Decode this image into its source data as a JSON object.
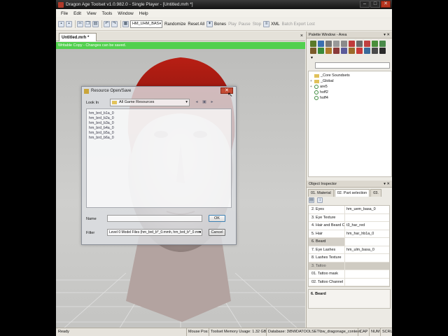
{
  "window": {
    "title": "Dragon Age Toolset v1.0.982.0 - Single Player - [Untitled.mrh *]",
    "minimize": "–",
    "maximize": "□",
    "close": "✕"
  },
  "menu": [
    "File",
    "Edit",
    "View",
    "Tools",
    "Window",
    "Help"
  ],
  "toolbar": {
    "model_combo": "HM_UHM_BAS",
    "buttons": [
      "Randomize",
      "Reset All",
      "Bones"
    ],
    "disabled_buttons": [
      "Play",
      "Pause",
      "Stop"
    ],
    "xml": "XML",
    "batch_export": "Batch Export Lost"
  },
  "document": {
    "tab_label": "Untitled.mrh *",
    "notice": "Writable Copy - Changes can be saved."
  },
  "dialog": {
    "title": "Resource Open/Save",
    "close": "✕",
    "look_in_label": "Look In",
    "look_in_value": "All Game Resources",
    "files": [
      "hm_brd_b1a_0",
      "hm_brd_b2a_0",
      "hm_brd_b3a_0",
      "hm_brd_b4a_0",
      "hm_brd_b5a_0",
      "hm_brd_b6a_0"
    ],
    "name_label": "Name",
    "name_value": "",
    "filter_label": "Filter",
    "filter_value": "Level 0 Model Files (hm_brd_b*_0.mmh, hm_brd_b*_0.mm",
    "ok": "OK",
    "cancel": "Cancel"
  },
  "palette": {
    "title": "Palette Window - Area",
    "pin": "▾ ✕",
    "icon_colors": [
      "#5a7a2a",
      "#3a6fb0",
      "#777777",
      "#999999",
      "#8a8a8a",
      "#c03a3a",
      "#6a6a6a",
      "#c04040",
      "#4a8f3a",
      "#4a8a4a",
      "#7a5a2a",
      "#3a8a3a",
      "#b07a2a",
      "#8a3a3a",
      "#5a5a9a",
      "#9a6a2a",
      "#c83a3a",
      "#3a6a9a",
      "#4a4a4a",
      "#2a2a2a"
    ],
    "dropdown_icon": "▾",
    "search": "",
    "tree": [
      {
        "label": "_Core Soundsets",
        "type": "folder",
        "expander": ""
      },
      {
        "label": "_Global",
        "type": "folder",
        "expander": "+"
      },
      {
        "label": "are5",
        "type": "res",
        "expander": "+"
      },
      {
        "label": "hoff2",
        "type": "res",
        "expander": ""
      },
      {
        "label": "hoff4",
        "type": "res",
        "expander": ""
      }
    ]
  },
  "object_inspector": {
    "title": "Object Inspector",
    "pin": "▾ ✕",
    "tabs": [
      "01. Material",
      "02. Part selection",
      "03."
    ],
    "properties": [
      {
        "name": "2. Eyes",
        "value": "hm_uem_basa_0"
      },
      {
        "name": "3. Eye Texture",
        "value": ""
      },
      {
        "name": "4. Hair and Beard Co",
        "value": "t3_har_red"
      },
      {
        "name": "5. Hair",
        "value": "hm_har_hb1a_0"
      },
      {
        "name": "6. Beard",
        "value": ""
      },
      {
        "name": "7. Eye Lashes",
        "value": "hm_ulm_basa_0"
      },
      {
        "name": "8. Lashes Texture",
        "value": ""
      },
      {
        "name": "3. Tattoo",
        "value": ""
      },
      {
        "name": "01. Tattoo mask",
        "value": ""
      },
      {
        "name": "02. Tattoo Channel 1",
        "value": ""
      }
    ],
    "description": "6. Beard"
  },
  "status": {
    "left": "Ready",
    "mouse_pos": "Mouse Pos:",
    "memory": "Toolset Memory Usage: 1.32 GB",
    "database": "Database: 3\\BWDATOOLSET\\bw_dragonage_content",
    "cap": "CAP",
    "num": "NUM",
    "scrl": "SCRL"
  }
}
